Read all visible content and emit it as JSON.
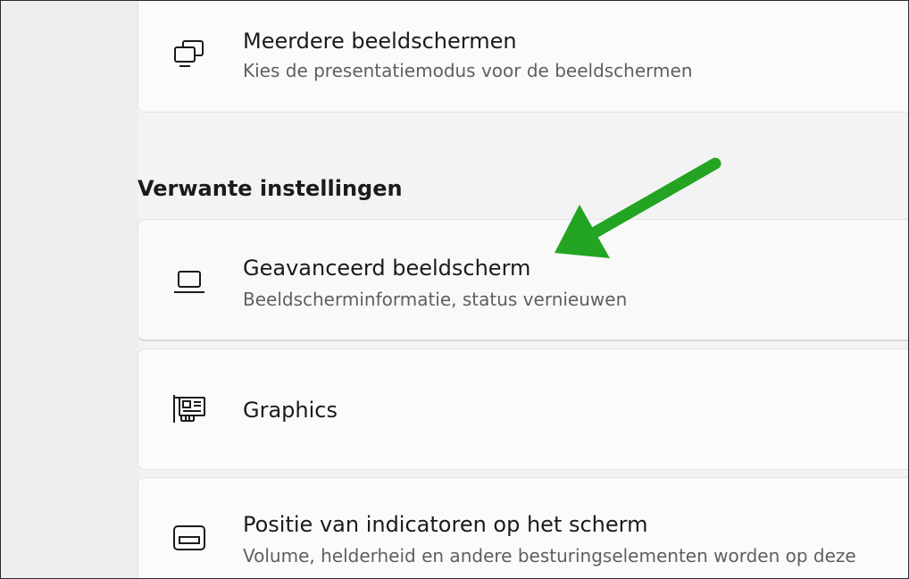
{
  "cards": [
    {
      "title": "Meerdere beeldschermen",
      "description": "Kies de presentatiemodus voor de beeldschermen",
      "icon": "multiple-displays-icon"
    },
    {
      "title": "Geavanceerd beeldscherm",
      "description": "Beeldscherminformatie, status vernieuwen",
      "icon": "laptop-icon"
    },
    {
      "title": "Graphics",
      "icon": "graphics-card-icon"
    },
    {
      "title": "Positie van indicatoren op het scherm",
      "description": "Volume, helderheid en andere besturingselementen worden op deze",
      "icon": "indicator-position-icon"
    }
  ],
  "related_settings_header": "Verwante instellingen",
  "colors": {
    "annotation_arrow": "#23a423",
    "card_background": "#fbfbfb",
    "page_background": "#f3f3f3"
  }
}
